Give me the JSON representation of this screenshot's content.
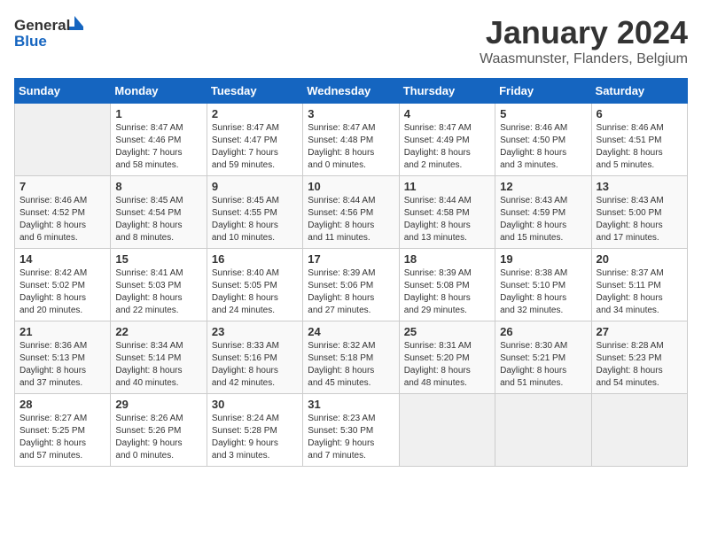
{
  "header": {
    "logo_general": "General",
    "logo_blue": "Blue",
    "month_title": "January 2024",
    "location": "Waasmunster, Flanders, Belgium"
  },
  "days_of_week": [
    "Sunday",
    "Monday",
    "Tuesday",
    "Wednesday",
    "Thursday",
    "Friday",
    "Saturday"
  ],
  "weeks": [
    [
      {
        "day": "",
        "info": ""
      },
      {
        "day": "1",
        "info": "Sunrise: 8:47 AM\nSunset: 4:46 PM\nDaylight: 7 hours\nand 58 minutes."
      },
      {
        "day": "2",
        "info": "Sunrise: 8:47 AM\nSunset: 4:47 PM\nDaylight: 7 hours\nand 59 minutes."
      },
      {
        "day": "3",
        "info": "Sunrise: 8:47 AM\nSunset: 4:48 PM\nDaylight: 8 hours\nand 0 minutes."
      },
      {
        "day": "4",
        "info": "Sunrise: 8:47 AM\nSunset: 4:49 PM\nDaylight: 8 hours\nand 2 minutes."
      },
      {
        "day": "5",
        "info": "Sunrise: 8:46 AM\nSunset: 4:50 PM\nDaylight: 8 hours\nand 3 minutes."
      },
      {
        "day": "6",
        "info": "Sunrise: 8:46 AM\nSunset: 4:51 PM\nDaylight: 8 hours\nand 5 minutes."
      }
    ],
    [
      {
        "day": "7",
        "info": "Sunrise: 8:46 AM\nSunset: 4:52 PM\nDaylight: 8 hours\nand 6 minutes."
      },
      {
        "day": "8",
        "info": "Sunrise: 8:45 AM\nSunset: 4:54 PM\nDaylight: 8 hours\nand 8 minutes."
      },
      {
        "day": "9",
        "info": "Sunrise: 8:45 AM\nSunset: 4:55 PM\nDaylight: 8 hours\nand 10 minutes."
      },
      {
        "day": "10",
        "info": "Sunrise: 8:44 AM\nSunset: 4:56 PM\nDaylight: 8 hours\nand 11 minutes."
      },
      {
        "day": "11",
        "info": "Sunrise: 8:44 AM\nSunset: 4:58 PM\nDaylight: 8 hours\nand 13 minutes."
      },
      {
        "day": "12",
        "info": "Sunrise: 8:43 AM\nSunset: 4:59 PM\nDaylight: 8 hours\nand 15 minutes."
      },
      {
        "day": "13",
        "info": "Sunrise: 8:43 AM\nSunset: 5:00 PM\nDaylight: 8 hours\nand 17 minutes."
      }
    ],
    [
      {
        "day": "14",
        "info": "Sunrise: 8:42 AM\nSunset: 5:02 PM\nDaylight: 8 hours\nand 20 minutes."
      },
      {
        "day": "15",
        "info": "Sunrise: 8:41 AM\nSunset: 5:03 PM\nDaylight: 8 hours\nand 22 minutes."
      },
      {
        "day": "16",
        "info": "Sunrise: 8:40 AM\nSunset: 5:05 PM\nDaylight: 8 hours\nand 24 minutes."
      },
      {
        "day": "17",
        "info": "Sunrise: 8:39 AM\nSunset: 5:06 PM\nDaylight: 8 hours\nand 27 minutes."
      },
      {
        "day": "18",
        "info": "Sunrise: 8:39 AM\nSunset: 5:08 PM\nDaylight: 8 hours\nand 29 minutes."
      },
      {
        "day": "19",
        "info": "Sunrise: 8:38 AM\nSunset: 5:10 PM\nDaylight: 8 hours\nand 32 minutes."
      },
      {
        "day": "20",
        "info": "Sunrise: 8:37 AM\nSunset: 5:11 PM\nDaylight: 8 hours\nand 34 minutes."
      }
    ],
    [
      {
        "day": "21",
        "info": "Sunrise: 8:36 AM\nSunset: 5:13 PM\nDaylight: 8 hours\nand 37 minutes."
      },
      {
        "day": "22",
        "info": "Sunrise: 8:34 AM\nSunset: 5:14 PM\nDaylight: 8 hours\nand 40 minutes."
      },
      {
        "day": "23",
        "info": "Sunrise: 8:33 AM\nSunset: 5:16 PM\nDaylight: 8 hours\nand 42 minutes."
      },
      {
        "day": "24",
        "info": "Sunrise: 8:32 AM\nSunset: 5:18 PM\nDaylight: 8 hours\nand 45 minutes."
      },
      {
        "day": "25",
        "info": "Sunrise: 8:31 AM\nSunset: 5:20 PM\nDaylight: 8 hours\nand 48 minutes."
      },
      {
        "day": "26",
        "info": "Sunrise: 8:30 AM\nSunset: 5:21 PM\nDaylight: 8 hours\nand 51 minutes."
      },
      {
        "day": "27",
        "info": "Sunrise: 8:28 AM\nSunset: 5:23 PM\nDaylight: 8 hours\nand 54 minutes."
      }
    ],
    [
      {
        "day": "28",
        "info": "Sunrise: 8:27 AM\nSunset: 5:25 PM\nDaylight: 8 hours\nand 57 minutes."
      },
      {
        "day": "29",
        "info": "Sunrise: 8:26 AM\nSunset: 5:26 PM\nDaylight: 9 hours\nand 0 minutes."
      },
      {
        "day": "30",
        "info": "Sunrise: 8:24 AM\nSunset: 5:28 PM\nDaylight: 9 hours\nand 3 minutes."
      },
      {
        "day": "31",
        "info": "Sunrise: 8:23 AM\nSunset: 5:30 PM\nDaylight: 9 hours\nand 7 minutes."
      },
      {
        "day": "",
        "info": ""
      },
      {
        "day": "",
        "info": ""
      },
      {
        "day": "",
        "info": ""
      }
    ]
  ]
}
